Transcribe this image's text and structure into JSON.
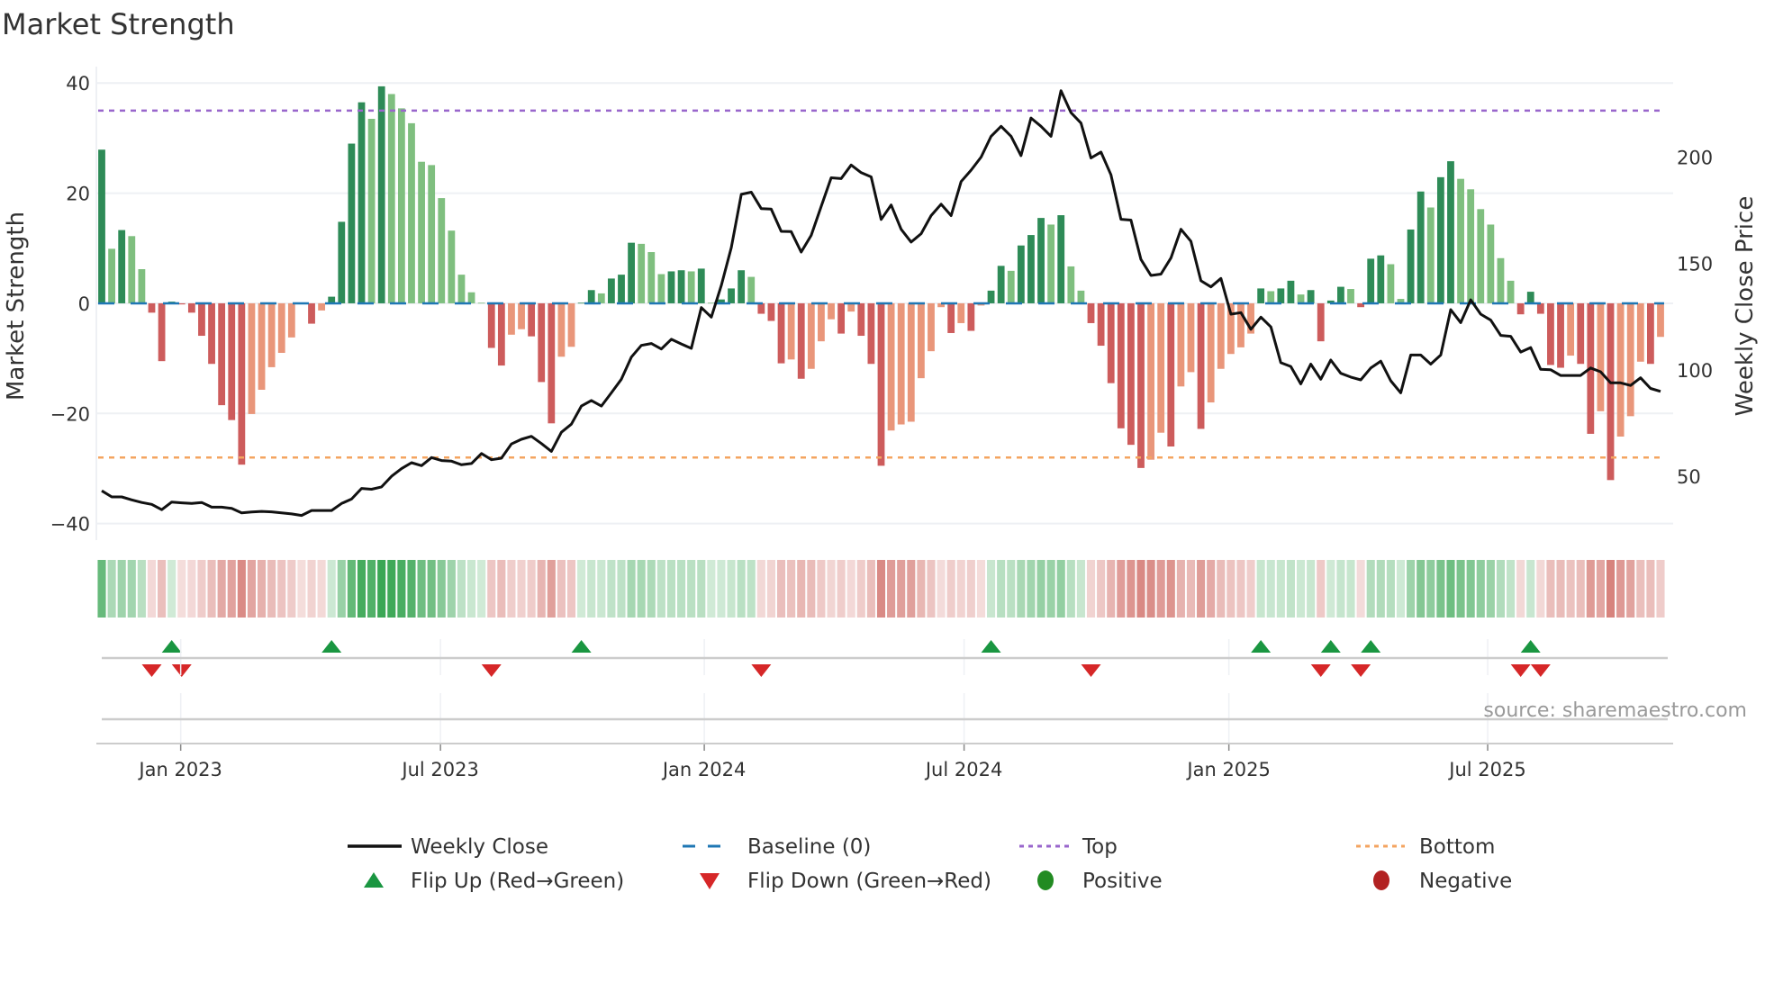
{
  "title": "Market Strength",
  "source": "source: sharemaestro.com",
  "chart_data": {
    "type": "bar",
    "title": "Market Strength",
    "ylabel": "Market Strength",
    "y2label": "Weekly Close Price",
    "ylim": [
      -43,
      42
    ],
    "y2lim": [
      20,
      240
    ],
    "yticks": [
      40,
      20,
      0,
      -20,
      -40
    ],
    "yticks_labels": [
      "40",
      "20",
      "0",
      "−20",
      "−40"
    ],
    "y2ticks": [
      200,
      150,
      100,
      50
    ],
    "y2ticks_labels": [
      "200",
      "150",
      "100",
      "50"
    ],
    "x_unit": "week index",
    "xticks": [
      {
        "label": "Jan 2023",
        "at": 7.9
      },
      {
        "label": "Jul 2023",
        "at": 33.9
      },
      {
        "label": "Jan 2024",
        "at": 60.3
      },
      {
        "label": "Jul 2024",
        "at": 86.3
      },
      {
        "label": "Jan 2025",
        "at": 112.8
      },
      {
        "label": "Jul 2025",
        "at": 138.7
      }
    ],
    "grid": true,
    "top_level": 35,
    "bottom_level": -28,
    "baseline": 0,
    "colors": {
      "pos_rising": "#2e8b57",
      "pos_falling": "#7fbf7f",
      "neg_falling": "#cd5c5c",
      "neg_rising": "#e9967a",
      "baseline": "#1f77b4",
      "top": "#9966cc",
      "bottom": "#f4a460",
      "price": "#111111",
      "flip_up": "#1a9641",
      "flip_down": "#d62728",
      "positive": "#228b22",
      "negative": "#b22222"
    },
    "strength": [
      27.9,
      9.9,
      13.3,
      12.2,
      6.2,
      -1.7,
      -10.5,
      0.3,
      -0.2,
      -1.7,
      -5.9,
      -11,
      -18.5,
      -21.2,
      -29.3,
      -20.1,
      -15.7,
      -11.6,
      -9,
      -6.2,
      -0.1,
      -3.7,
      -1.3,
      1.2,
      14.8,
      29,
      36.5,
      33.5,
      39.4,
      38,
      35.4,
      32.7,
      25.7,
      25.1,
      19.1,
      13.2,
      5.2,
      2,
      0.1,
      -8.1,
      -11.3,
      -5.7,
      -4.7,
      -6,
      -14.3,
      -21.8,
      -9.7,
      -7.9,
      0.1,
      2.4,
      1.8,
      4.5,
      5.2,
      11,
      10.8,
      9.3,
      5.3,
      5.8,
      6,
      5.8,
      6.3,
      0.1,
      0.7,
      2.7,
      6,
      4.8,
      -1.9,
      -3.2,
      -10.9,
      -10.2,
      -13.7,
      -11.9,
      -6.9,
      -2.9,
      -5.5,
      -1.5,
      -5.9,
      -11,
      -29.5,
      -23.1,
      -22,
      -21.5,
      -13.6,
      -8.7,
      -0.7,
      -5.4,
      -3.6,
      -5,
      -0.4,
      2.3,
      6.8,
      5.9,
      10.5,
      12.4,
      15.5,
      14.3,
      16,
      6.7,
      2.3,
      -3.6,
      -7.7,
      -14.5,
      -22.7,
      -25.7,
      -29.9,
      -28.4,
      -23.5,
      -26,
      -15.1,
      -12.5,
      -22.8,
      -18,
      -11.9,
      -9.2,
      -8,
      -5.5,
      2.7,
      2.2,
      2.7,
      4.1,
      1.6,
      2.4,
      -6.9,
      0.5,
      3,
      2.6,
      -0.7,
      8.1,
      8.7,
      7.1,
      0.8,
      13.4,
      20.3,
      17.4,
      22.9,
      25.8,
      22.6,
      20.7,
      17.1,
      14.3,
      8.2,
      4.1,
      -2,
      2.1,
      -1.9,
      -11.2,
      -11.7,
      -9.5,
      -11,
      -23.7,
      -19.6,
      -32.1,
      -24.2,
      -20.5,
      -10.6,
      -11,
      -6.1
    ],
    "weekly_close": [
      43.2,
      40.3,
      40.3,
      38.9,
      37.7,
      36.8,
      34.3,
      37.9,
      37.5,
      37.2,
      37.7,
      35.5,
      35.5,
      34.9,
      32.8,
      33.2,
      33.5,
      33.3,
      32.8,
      32.3,
      31.6,
      33.9,
      33.9,
      33.9,
      37.2,
      39.3,
      44.3,
      43.9,
      45,
      50,
      53.6,
      56.4,
      55,
      58.8,
      57.4,
      57.1,
      55.4,
      56,
      60.7,
      57.8,
      58.5,
      65.2,
      67.4,
      68.8,
      65.4,
      61.7,
      70.7,
      74.5,
      83,
      85.6,
      83,
      89.2,
      95.6,
      106,
      111.5,
      112.4,
      109.8,
      114.4,
      112.2,
      110.1,
      129.3,
      124.8,
      139.7,
      157.5,
      182.5,
      183.5,
      175.8,
      175.6,
      165.1,
      165,
      155.4,
      163.2,
      176.8,
      190.3,
      189.9,
      196.3,
      192.7,
      190.7,
      170.7,
      177.5,
      166.1,
      160.1,
      164,
      172.5,
      177.9,
      172.5,
      188.5,
      193.9,
      200,
      209.8,
      214.5,
      209.8,
      200.7,
      218.4,
      214.5,
      209.8,
      231.2,
      220.9,
      216,
      199.6,
      202.4,
      191.7,
      170.8,
      170.4,
      151.9,
      144.4,
      145,
      152.6,
      166.1,
      160.4,
      141.9,
      139,
      143,
      126.2,
      126.9,
      119.1,
      124.8,
      120.2,
      103.4,
      101.6,
      93.4,
      102.7,
      95.6,
      104.6,
      98.4,
      96.6,
      95.3,
      100.9,
      104.1,
      94.9,
      89.2,
      107,
      107,
      102.7,
      107,
      128.3,
      122.2,
      132.9,
      126.2,
      123.4,
      116.2,
      115.8,
      108.4,
      110.5,
      100.3,
      100.1,
      97.4,
      97.4,
      97.4,
      100.9,
      99.1,
      93.9,
      93.9,
      92.7,
      96.3,
      91.3,
      89.9
    ],
    "flip_up_weeks": [
      7,
      23,
      48,
      89,
      116,
      123,
      127,
      143
    ],
    "flip_down_weeks": [
      5,
      8,
      39,
      66,
      99,
      122,
      126,
      142,
      144
    ],
    "legend_position": "bottom",
    "legend": [
      {
        "key": "weekly_close",
        "label": "Weekly Close"
      },
      {
        "key": "baseline",
        "label": "Baseline (0)"
      },
      {
        "key": "top",
        "label": "Top"
      },
      {
        "key": "bottom",
        "label": "Bottom"
      },
      {
        "key": "flip_up",
        "label": "Flip Up (Red→Green)"
      },
      {
        "key": "flip_down",
        "label": "Flip Down (Green→Red)"
      },
      {
        "key": "positive",
        "label": "Positive"
      },
      {
        "key": "negative",
        "label": "Negative"
      }
    ]
  }
}
